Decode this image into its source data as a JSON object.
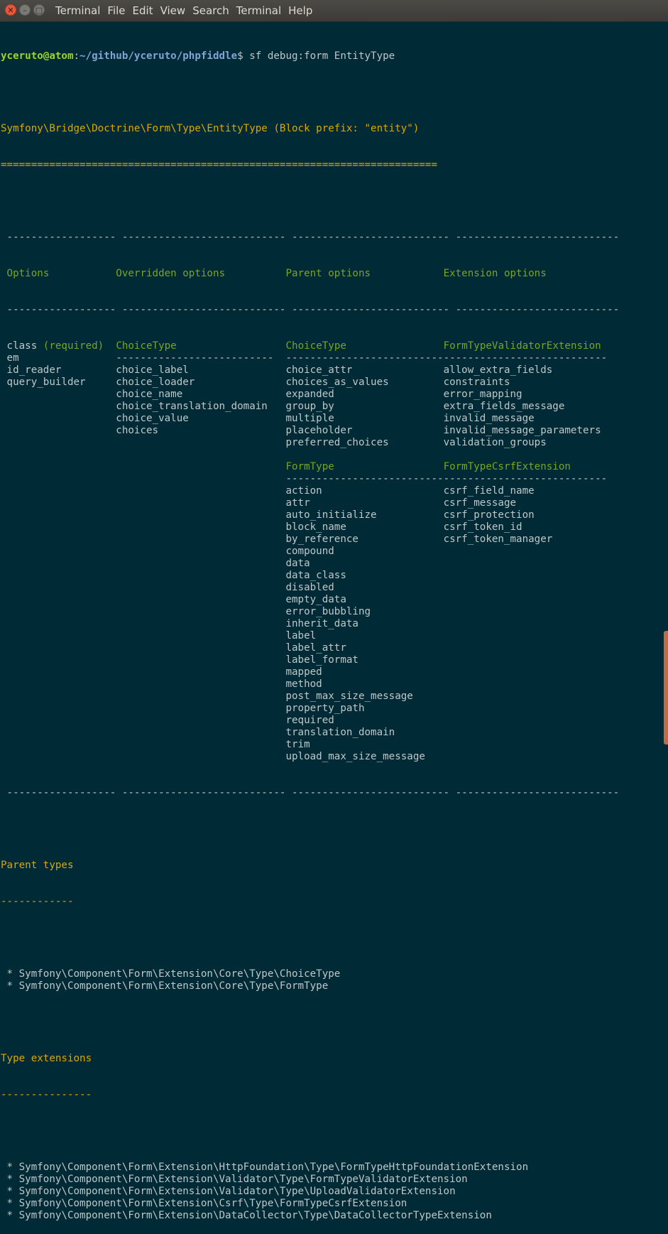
{
  "window": {
    "menu": [
      "Terminal",
      "File",
      "Edit",
      "View",
      "Search",
      "Terminal",
      "Help"
    ]
  },
  "prompt": {
    "user_host": "yceruto@atom",
    "path": "~/github/yceruto/phpfiddle",
    "command": "$ sf debug:form EntityType"
  },
  "form": {
    "heading": "Symfony\\Bridge\\Doctrine\\Form\\Type\\EntityType (Block prefix: \"entity\")",
    "heading_underline": "========================================================================"
  },
  "table": {
    "border": " ------------------ --------------------------- -------------------------- ---------------------------",
    "headers": [
      "Options",
      "Overridden options",
      "Parent options",
      "Extension options"
    ],
    "rows": [
      [
        {
          "t": "class"
        },
        {
          "t": "ChoiceType",
          "h": 1
        },
        {
          "t": "ChoiceType",
          "h": 1
        },
        {
          "t": "FormTypeValidatorExtension",
          "h": 1
        }
      ],
      [
        {
          "t": "em"
        },
        {
          "t": "--------------------------",
          "h": 1,
          "d": 1
        },
        {
          "t": "--------------------------",
          "d": 1
        },
        {
          "t": "---------------------------",
          "d": 1
        }
      ],
      [
        {
          "t": "id_reader"
        },
        {
          "t": "choice_label"
        },
        {
          "t": "choice_attr"
        },
        {
          "t": "allow_extra_fields"
        }
      ],
      [
        {
          "t": "query_builder"
        },
        {
          "t": "choice_loader"
        },
        {
          "t": "choices_as_values"
        },
        {
          "t": "constraints"
        }
      ],
      [
        {
          "t": ""
        },
        {
          "t": "choice_name"
        },
        {
          "t": "expanded"
        },
        {
          "t": "error_mapping"
        }
      ],
      [
        {
          "t": ""
        },
        {
          "t": "choice_translation_domain"
        },
        {
          "t": "group_by"
        },
        {
          "t": "extra_fields_message"
        }
      ],
      [
        {
          "t": ""
        },
        {
          "t": "choice_value"
        },
        {
          "t": "multiple"
        },
        {
          "t": "invalid_message"
        }
      ],
      [
        {
          "t": ""
        },
        {
          "t": "choices"
        },
        {
          "t": "placeholder"
        },
        {
          "t": "invalid_message_parameters"
        }
      ],
      [
        {
          "t": ""
        },
        {
          "t": ""
        },
        {
          "t": "preferred_choices"
        },
        {
          "t": "validation_groups"
        }
      ],
      [
        {
          "t": ""
        },
        {
          "t": ""
        },
        {
          "t": ""
        },
        {
          "t": ""
        }
      ],
      [
        {
          "t": ""
        },
        {
          "t": ""
        },
        {
          "t": "FormType",
          "h": 1
        },
        {
          "t": "FormTypeCsrfExtension",
          "h": 1
        }
      ],
      [
        {
          "t": ""
        },
        {
          "t": ""
        },
        {
          "t": "--------------------------",
          "d": 1
        },
        {
          "t": "---------------------------",
          "d": 1
        }
      ],
      [
        {
          "t": ""
        },
        {
          "t": ""
        },
        {
          "t": "action"
        },
        {
          "t": "csrf_field_name"
        }
      ],
      [
        {
          "t": ""
        },
        {
          "t": ""
        },
        {
          "t": "attr"
        },
        {
          "t": "csrf_message"
        }
      ],
      [
        {
          "t": ""
        },
        {
          "t": ""
        },
        {
          "t": "auto_initialize"
        },
        {
          "t": "csrf_protection"
        }
      ],
      [
        {
          "t": ""
        },
        {
          "t": ""
        },
        {
          "t": "block_name"
        },
        {
          "t": "csrf_token_id"
        }
      ],
      [
        {
          "t": ""
        },
        {
          "t": ""
        },
        {
          "t": "by_reference"
        },
        {
          "t": "csrf_token_manager"
        }
      ],
      [
        {
          "t": ""
        },
        {
          "t": ""
        },
        {
          "t": "compound"
        },
        {
          "t": ""
        }
      ],
      [
        {
          "t": ""
        },
        {
          "t": ""
        },
        {
          "t": "data"
        },
        {
          "t": ""
        }
      ],
      [
        {
          "t": ""
        },
        {
          "t": ""
        },
        {
          "t": "data_class"
        },
        {
          "t": ""
        }
      ],
      [
        {
          "t": ""
        },
        {
          "t": ""
        },
        {
          "t": "disabled"
        },
        {
          "t": ""
        }
      ],
      [
        {
          "t": ""
        },
        {
          "t": ""
        },
        {
          "t": "empty_data"
        },
        {
          "t": ""
        }
      ],
      [
        {
          "t": ""
        },
        {
          "t": ""
        },
        {
          "t": "error_bubbling"
        },
        {
          "t": ""
        }
      ],
      [
        {
          "t": ""
        },
        {
          "t": ""
        },
        {
          "t": "inherit_data"
        },
        {
          "t": ""
        }
      ],
      [
        {
          "t": ""
        },
        {
          "t": ""
        },
        {
          "t": "label"
        },
        {
          "t": ""
        }
      ],
      [
        {
          "t": ""
        },
        {
          "t": ""
        },
        {
          "t": "label_attr"
        },
        {
          "t": ""
        }
      ],
      [
        {
          "t": ""
        },
        {
          "t": ""
        },
        {
          "t": "label_format"
        },
        {
          "t": ""
        }
      ],
      [
        {
          "t": ""
        },
        {
          "t": ""
        },
        {
          "t": "mapped"
        },
        {
          "t": ""
        }
      ],
      [
        {
          "t": ""
        },
        {
          "t": ""
        },
        {
          "t": "method"
        },
        {
          "t": ""
        }
      ],
      [
        {
          "t": ""
        },
        {
          "t": ""
        },
        {
          "t": "post_max_size_message"
        },
        {
          "t": ""
        }
      ],
      [
        {
          "t": ""
        },
        {
          "t": ""
        },
        {
          "t": "property_path"
        },
        {
          "t": ""
        }
      ],
      [
        {
          "t": ""
        },
        {
          "t": ""
        },
        {
          "t": "required"
        },
        {
          "t": ""
        }
      ],
      [
        {
          "t": ""
        },
        {
          "t": ""
        },
        {
          "t": "translation_domain"
        },
        {
          "t": ""
        }
      ],
      [
        {
          "t": ""
        },
        {
          "t": ""
        },
        {
          "t": "trim"
        },
        {
          "t": ""
        }
      ],
      [
        {
          "t": ""
        },
        {
          "t": ""
        },
        {
          "t": "upload_max_size_message"
        },
        {
          "t": ""
        }
      ]
    ],
    "required_marker": "(required)"
  },
  "parent_types": {
    "title": "Parent types",
    "underline": "------------",
    "items": [
      " * Symfony\\Component\\Form\\Extension\\Core\\Type\\ChoiceType",
      " * Symfony\\Component\\Form\\Extension\\Core\\Type\\FormType"
    ]
  },
  "type_extensions": {
    "title": "Type extensions",
    "underline": "---------------",
    "items": [
      " * Symfony\\Component\\Form\\Extension\\HttpFoundation\\Type\\FormTypeHttpFoundationExtension",
      " * Symfony\\Component\\Form\\Extension\\Validator\\Type\\FormTypeValidatorExtension",
      " * Symfony\\Component\\Form\\Extension\\Validator\\Type\\UploadValidatorExtension",
      " * Symfony\\Component\\Form\\Extension\\Csrf\\Type\\FormTypeCsrfExtension",
      " * Symfony\\Component\\Form\\Extension\\DataCollector\\Type\\DataCollectorTypeExtension"
    ]
  }
}
